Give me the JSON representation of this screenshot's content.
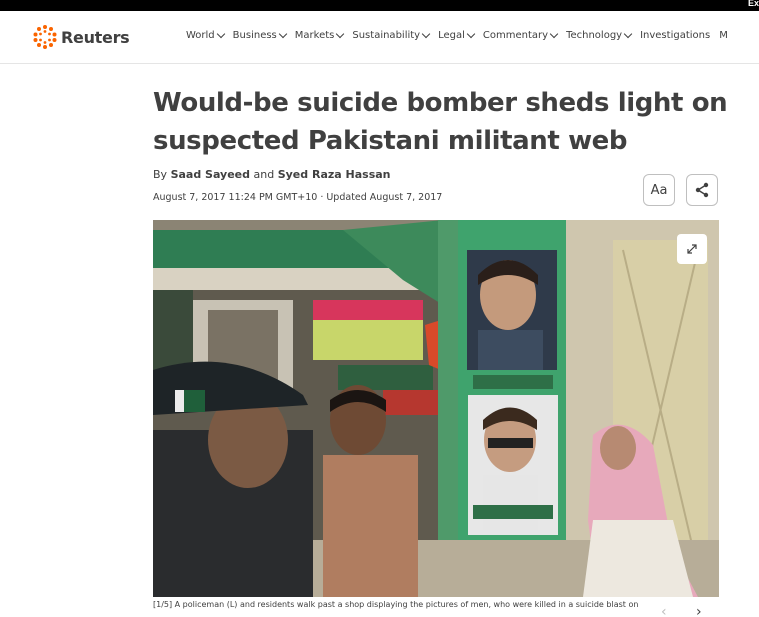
{
  "topbar": {
    "text": "Ex"
  },
  "logo": {
    "text": "Reuters",
    "color": "#fa6400"
  },
  "nav": {
    "items": [
      {
        "label": "World"
      },
      {
        "label": "Business"
      },
      {
        "label": "Markets"
      },
      {
        "label": "Sustainability"
      },
      {
        "label": "Legal"
      },
      {
        "label": "Commentary"
      },
      {
        "label": "Technology"
      },
      {
        "label": "Investigations"
      },
      {
        "label": "M"
      }
    ]
  },
  "article": {
    "headline": "Would-be suicide bomber sheds light on suspected Pakistani militant web",
    "by_prefix": "By",
    "author1": "Saad Sayeed",
    "and": "and",
    "author2": "Syed Raza Hassan",
    "dateline": "August 7, 2017 11:24 PM GMT+10 · Updated August 7, 2017",
    "font_button": "Aa",
    "caption": "[1/5] A policeman (L) and residents walk past a shop displaying the pictures of men, who were killed in a suicide blast on",
    "gallery_prev": "‹",
    "gallery_next": "›"
  }
}
